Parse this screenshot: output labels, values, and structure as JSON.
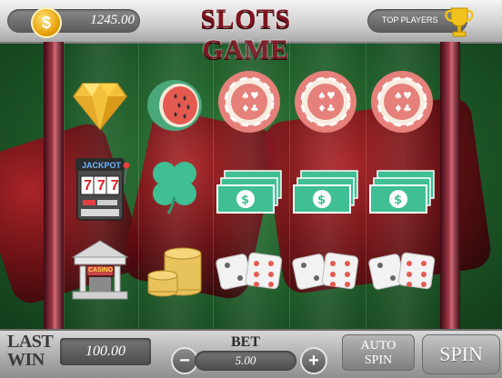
{
  "header": {
    "coin_value": "1245.00",
    "coin_symbol": "$",
    "title": "SLOTS GAME",
    "top_players_label": "TOP PLAYERS"
  },
  "reels": [
    [
      "diamond",
      "slot-machine",
      "casino-building"
    ],
    [
      "watermelon",
      "clover",
      "coin-stack"
    ],
    [
      "poker-chip",
      "cash",
      "dice"
    ],
    [
      "poker-chip",
      "cash",
      "dice"
    ],
    [
      "poker-chip",
      "cash",
      "dice"
    ]
  ],
  "slot_machine_label": "JACKPOT",
  "slot_machine_digits": "777",
  "casino_label": "CASINO",
  "footer": {
    "last_win_label_1": "LAST",
    "last_win_label_2": "WIN",
    "last_win_value": "100.00",
    "bet_label": "BET",
    "bet_value": "5.00",
    "minus": "−",
    "plus": "+",
    "auto_spin_1": "AUTO",
    "auto_spin_2": "SPIN",
    "spin_label": "SPIN"
  },
  "colors": {
    "title": "#7e1520",
    "felt": "#2f7a3a",
    "cash": "#3fbf93"
  }
}
